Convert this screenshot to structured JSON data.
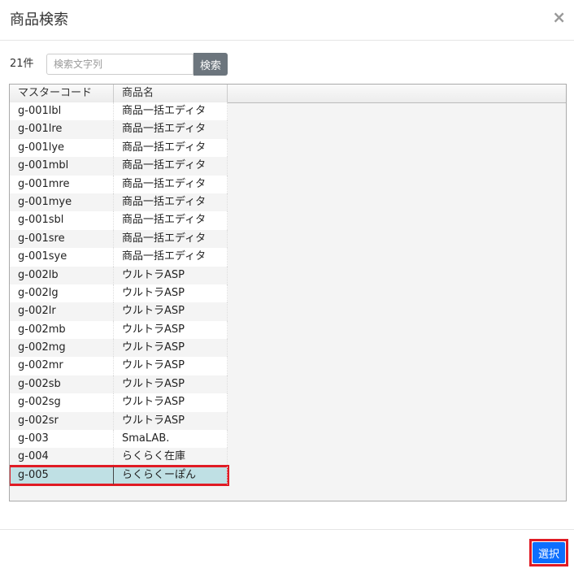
{
  "modal": {
    "title": "商品検索",
    "close_glyph": "×"
  },
  "search": {
    "count_label": "21件",
    "placeholder": "検索文字列",
    "button_label": "検索"
  },
  "table": {
    "columns": [
      "マスターコード",
      "商品名"
    ],
    "rows": [
      {
        "code": "g-001lbl",
        "name": "商品一括エディタ"
      },
      {
        "code": "g-001lre",
        "name": "商品一括エディタ"
      },
      {
        "code": "g-001lye",
        "name": "商品一括エディタ"
      },
      {
        "code": "g-001mbl",
        "name": "商品一括エディタ"
      },
      {
        "code": "g-001mre",
        "name": "商品一括エディタ"
      },
      {
        "code": "g-001mye",
        "name": "商品一括エディタ"
      },
      {
        "code": "g-001sbl",
        "name": "商品一括エディタ"
      },
      {
        "code": "g-001sre",
        "name": "商品一括エディタ"
      },
      {
        "code": "g-001sye",
        "name": "商品一括エディタ"
      },
      {
        "code": "g-002lb",
        "name": "ウルトラASP"
      },
      {
        "code": "g-002lg",
        "name": "ウルトラASP"
      },
      {
        "code": "g-002lr",
        "name": "ウルトラASP"
      },
      {
        "code": "g-002mb",
        "name": "ウルトラASP"
      },
      {
        "code": "g-002mg",
        "name": "ウルトラASP"
      },
      {
        "code": "g-002mr",
        "name": "ウルトラASP"
      },
      {
        "code": "g-002sb",
        "name": "ウルトラASP"
      },
      {
        "code": "g-002sg",
        "name": "ウルトラASP"
      },
      {
        "code": "g-002sr",
        "name": "ウルトラASP"
      },
      {
        "code": "g-003",
        "name": "SmaLAB."
      },
      {
        "code": "g-004",
        "name": "らくらく在庫"
      },
      {
        "code": "g-005",
        "name": "らくらくーぽん",
        "selected": true
      }
    ]
  },
  "footer": {
    "select_label": "選択"
  },
  "colors": {
    "selected_row": "#bfe0e4",
    "highlight_border": "#e01b24",
    "primary_button": "#0d6efd",
    "search_button": "#6c757d"
  }
}
